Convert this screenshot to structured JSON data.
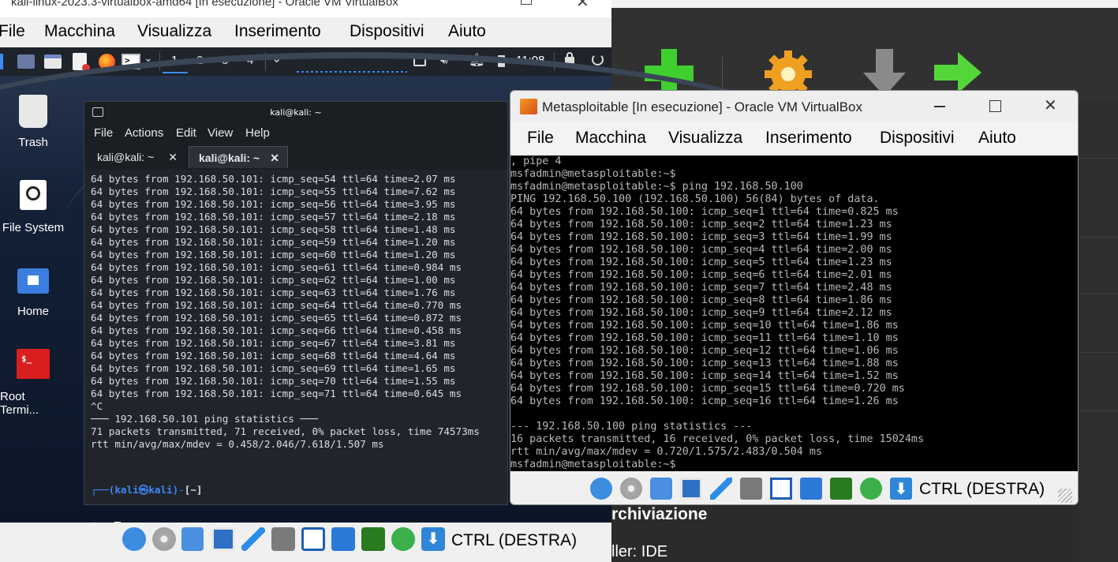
{
  "kali_window": {
    "title": "kali-linux-2023.3-virtualbox-amd64 [In esecuzione] - Oracle VM VirtualBox",
    "menu": [
      "File",
      "Macchina",
      "Visualizza",
      "Inserimento",
      "Dispositivi",
      "Aiuto"
    ],
    "panel": {
      "workspaces": [
        "1",
        "2",
        "3",
        "4"
      ],
      "clock": "11:08"
    },
    "desktop_icons": [
      {
        "label": "Trash",
        "icon": "trash-icon"
      },
      {
        "label": "File System",
        "icon": "drive-icon"
      },
      {
        "label": "Home",
        "icon": "home-folder-icon"
      },
      {
        "label": "Root Termi...",
        "icon": "terminal-icon"
      }
    ],
    "host_key": "CTRL (DESTRA)"
  },
  "terminal": {
    "title": "kali@kali: ~",
    "menu": [
      "File",
      "Actions",
      "Edit",
      "View",
      "Help"
    ],
    "tabs": [
      "kali@kali: ~",
      "kali@kali: ~"
    ],
    "active_tab": 1,
    "output": [
      "64 bytes from 192.168.50.101: icmp_seq=54 ttl=64 time=2.07 ms",
      "64 bytes from 192.168.50.101: icmp_seq=55 ttl=64 time=7.62 ms",
      "64 bytes from 192.168.50.101: icmp_seq=56 ttl=64 time=3.95 ms",
      "64 bytes from 192.168.50.101: icmp_seq=57 ttl=64 time=2.18 ms",
      "64 bytes from 192.168.50.101: icmp_seq=58 ttl=64 time=1.48 ms",
      "64 bytes from 192.168.50.101: icmp_seq=59 ttl=64 time=1.20 ms",
      "64 bytes from 192.168.50.101: icmp_seq=60 ttl=64 time=1.20 ms",
      "64 bytes from 192.168.50.101: icmp_seq=61 ttl=64 time=0.984 ms",
      "64 bytes from 192.168.50.101: icmp_seq=62 ttl=64 time=1.00 ms",
      "64 bytes from 192.168.50.101: icmp_seq=63 ttl=64 time=1.76 ms",
      "64 bytes from 192.168.50.101: icmp_seq=64 ttl=64 time=0.770 ms",
      "64 bytes from 192.168.50.101: icmp_seq=65 ttl=64 time=0.872 ms",
      "64 bytes from 192.168.50.101: icmp_seq=66 ttl=64 time=0.458 ms",
      "64 bytes from 192.168.50.101: icmp_seq=67 ttl=64 time=3.81 ms",
      "64 bytes from 192.168.50.101: icmp_seq=68 ttl=64 time=4.64 ms",
      "64 bytes from 192.168.50.101: icmp_seq=69 ttl=64 time=1.65 ms",
      "64 bytes from 192.168.50.101: icmp_seq=70 ttl=64 time=1.55 ms",
      "64 bytes from 192.168.50.101: icmp_seq=71 ttl=64 time=0.645 ms",
      "^C",
      "─── 192.168.50.101 ping statistics ───",
      "71 packets transmitted, 71 received, 0% packet loss, time 74573ms",
      "rtt min/avg/max/mdev = 0.458/2.046/7.618/1.507 ms",
      ""
    ],
    "prompt_user": "(kali㉿kali)",
    "prompt_dir": "[~]",
    "prompt_symbol": "$"
  },
  "meta_window": {
    "title": "Metasploitable [In esecuzione] - Oracle VM VirtualBox",
    "menu": [
      "File",
      "Macchina",
      "Visualizza",
      "Inserimento",
      "Dispositivi",
      "Aiuto"
    ],
    "output": [
      ", pipe 4",
      "msfadmin@metasploitable:~$",
      "msfadmin@metasploitable:~$ ping 192.168.50.100",
      "PING 192.168.50.100 (192.168.50.100) 56(84) bytes of data.",
      "64 bytes from 192.168.50.100: icmp_seq=1 ttl=64 time=0.825 ms",
      "64 bytes from 192.168.50.100: icmp_seq=2 ttl=64 time=1.23 ms",
      "64 bytes from 192.168.50.100: icmp_seq=3 ttl=64 time=1.99 ms",
      "64 bytes from 192.168.50.100: icmp_seq=4 ttl=64 time=2.00 ms",
      "64 bytes from 192.168.50.100: icmp_seq=5 ttl=64 time=1.23 ms",
      "64 bytes from 192.168.50.100: icmp_seq=6 ttl=64 time=2.01 ms",
      "64 bytes from 192.168.50.100: icmp_seq=7 ttl=64 time=2.48 ms",
      "64 bytes from 192.168.50.100: icmp_seq=8 ttl=64 time=1.86 ms",
      "64 bytes from 192.168.50.100: icmp_seq=9 ttl=64 time=2.12 ms",
      "64 bytes from 192.168.50.100: icmp_seq=10 ttl=64 time=1.86 ms",
      "64 bytes from 192.168.50.100: icmp_seq=11 ttl=64 time=1.10 ms",
      "64 bytes from 192.168.50.100: icmp_seq=12 ttl=64 time=1.06 ms",
      "64 bytes from 192.168.50.100: icmp_seq=13 ttl=64 time=1.88 ms",
      "64 bytes from 192.168.50.100: icmp_seq=14 ttl=64 time=1.52 ms",
      "64 bytes from 192.168.50.100: icmp_seq=15 ttl=64 time=0.720 ms",
      "64 bytes from 192.168.50.100: icmp_seq=16 ttl=64 time=1.26 ms",
      "",
      "--- 192.168.50.100 ping statistics ---",
      "16 packets transmitted, 16 received, 0% packet loss, time 15024ms",
      "rtt min/avg/max/mdev = 0.720/1.575/2.483/0.504 ms",
      "msfadmin@metasploitable:~$"
    ],
    "host_key": "CTRL (DESTRA)"
  },
  "manager": {
    "section_heading": "rchiviazione",
    "controller": "ller: IDE"
  },
  "colors": {
    "kali_prompt": "#3f86f5",
    "terminal_bg": "#21252b",
    "vm_screen_bg": "#000000",
    "new_green": "#3fcf2f"
  }
}
